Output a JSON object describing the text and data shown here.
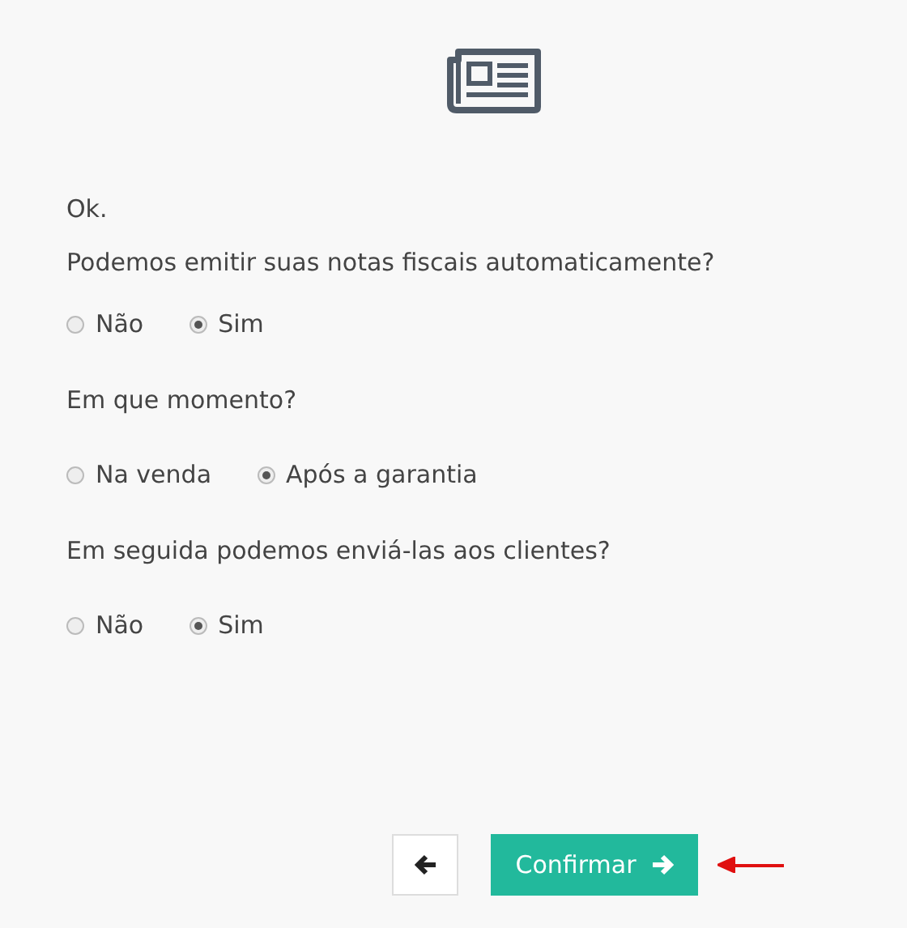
{
  "intro": "Ok.",
  "questions": [
    {
      "prompt": "Podemos emitir suas notas fiscais automaticamente?",
      "options": [
        {
          "label": "Não",
          "selected": false
        },
        {
          "label": "Sim",
          "selected": true
        }
      ]
    },
    {
      "prompt": "Em que momento?",
      "options": [
        {
          "label": "Na venda",
          "selected": false
        },
        {
          "label": "Após a garantia",
          "selected": true
        }
      ]
    },
    {
      "prompt": "Em seguida podemos enviá-las aos clientes?",
      "options": [
        {
          "label": "Não",
          "selected": false
        },
        {
          "label": "Sim",
          "selected": true
        }
      ]
    }
  ],
  "confirm_button": {
    "label": "Confirmar"
  }
}
